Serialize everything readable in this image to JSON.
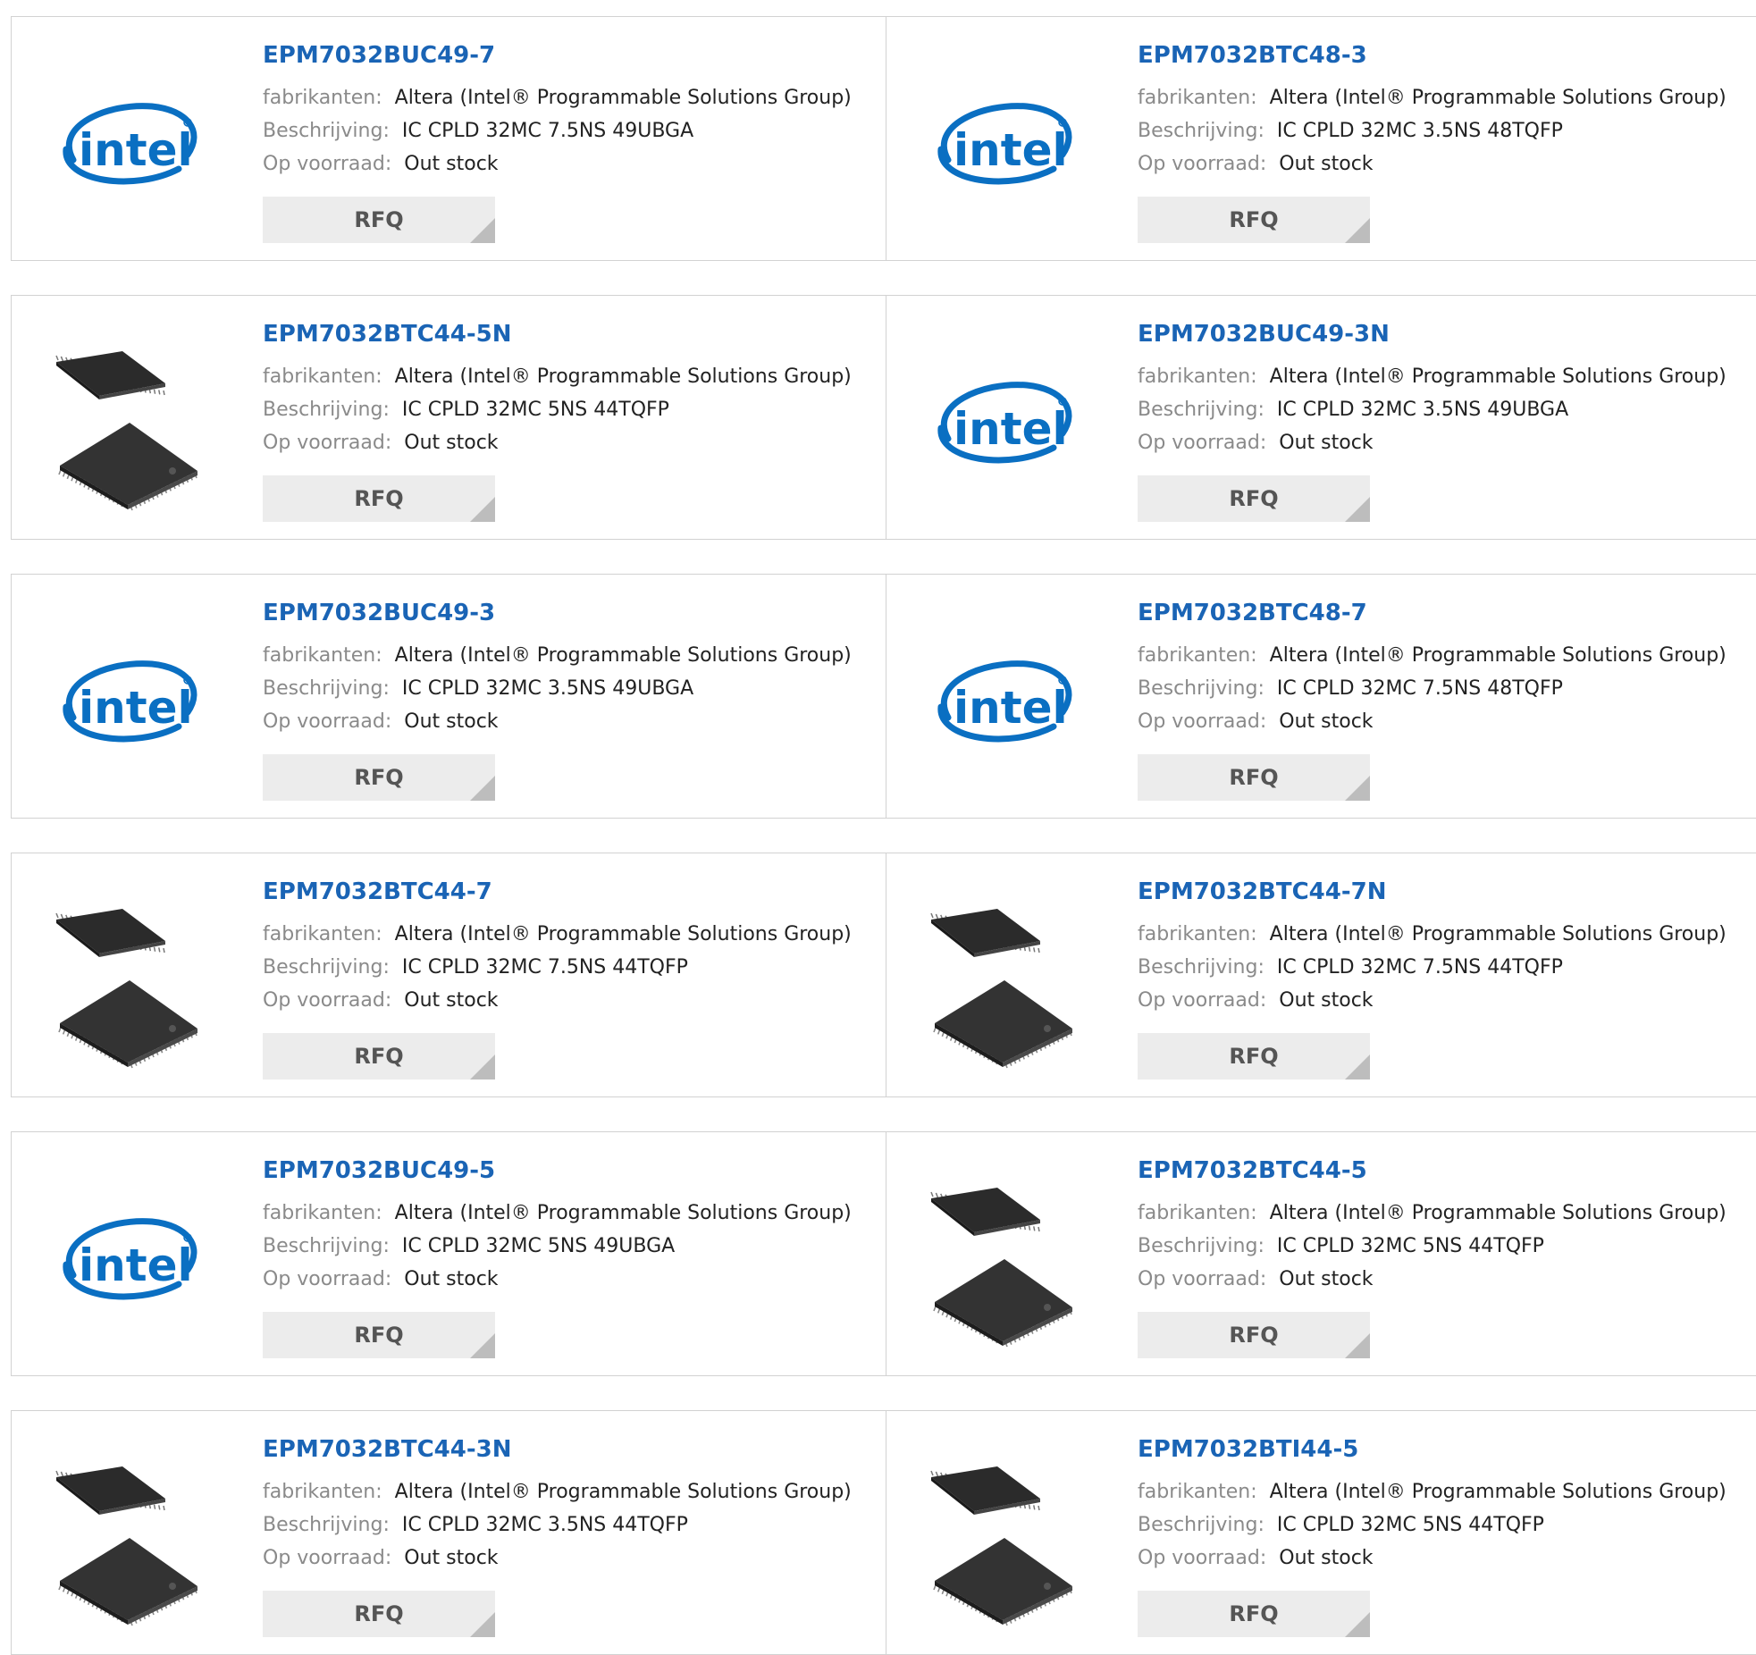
{
  "labels": {
    "manufacturer": "fabrikanten:",
    "description": "Beschrijving:",
    "stock": "Op voorraad:",
    "rfq": "RFQ"
  },
  "colors": {
    "part_link": "#1a64b5",
    "label_gray": "#8a8a8a",
    "rfq_bg": "#ececec",
    "intel_blue": "#0a6fc2"
  },
  "products": [
    {
      "part": "EPM7032BUC49-7",
      "manufacturer": "Altera (Intel® Programmable Solutions Group)",
      "description": "IC CPLD 32MC 7.5NS 49UBGA",
      "stock": "Out stock",
      "image": "intel-logo"
    },
    {
      "part": "EPM7032BTC48-3",
      "manufacturer": "Altera (Intel® Programmable Solutions Group)",
      "description": "IC CPLD 32MC 3.5NS 48TQFP",
      "stock": "Out stock",
      "image": "intel-logo"
    },
    {
      "part": "EPM7032BTC44-5N",
      "manufacturer": "Altera (Intel® Programmable Solutions Group)",
      "description": "IC CPLD 32MC 5NS 44TQFP",
      "stock": "Out stock",
      "image": "chip"
    },
    {
      "part": "EPM7032BUC49-3N",
      "manufacturer": "Altera (Intel® Programmable Solutions Group)",
      "description": "IC CPLD 32MC 3.5NS 49UBGA",
      "stock": "Out stock",
      "image": "intel-logo"
    },
    {
      "part": "EPM7032BUC49-3",
      "manufacturer": "Altera (Intel® Programmable Solutions Group)",
      "description": "IC CPLD 32MC 3.5NS 49UBGA",
      "stock": "Out stock",
      "image": "intel-logo"
    },
    {
      "part": "EPM7032BTC48-7",
      "manufacturer": "Altera (Intel® Programmable Solutions Group)",
      "description": "IC CPLD 32MC 7.5NS 48TQFP",
      "stock": "Out stock",
      "image": "intel-logo"
    },
    {
      "part": "EPM7032BTC44-7",
      "manufacturer": "Altera (Intel® Programmable Solutions Group)",
      "description": "IC CPLD 32MC 7.5NS 44TQFP",
      "stock": "Out stock",
      "image": "chip"
    },
    {
      "part": "EPM7032BTC44-7N",
      "manufacturer": "Altera (Intel® Programmable Solutions Group)",
      "description": "IC CPLD 32MC 7.5NS 44TQFP",
      "stock": "Out stock",
      "image": "chip"
    },
    {
      "part": "EPM7032BUC49-5",
      "manufacturer": "Altera (Intel® Programmable Solutions Group)",
      "description": "IC CPLD 32MC 5NS 49UBGA",
      "stock": "Out stock",
      "image": "intel-logo"
    },
    {
      "part": "EPM7032BTC44-5",
      "manufacturer": "Altera (Intel® Programmable Solutions Group)",
      "description": "IC CPLD 32MC 5NS 44TQFP",
      "stock": "Out stock",
      "image": "chip"
    },
    {
      "part": "EPM7032BTC44-3N",
      "manufacturer": "Altera (Intel® Programmable Solutions Group)",
      "description": "IC CPLD 32MC 3.5NS 44TQFP",
      "stock": "Out stock",
      "image": "chip"
    },
    {
      "part": "EPM7032BTI44-5",
      "manufacturer": "Altera (Intel® Programmable Solutions Group)",
      "description": "IC CPLD 32MC 5NS 44TQFP",
      "stock": "Out stock",
      "image": "chip"
    }
  ]
}
